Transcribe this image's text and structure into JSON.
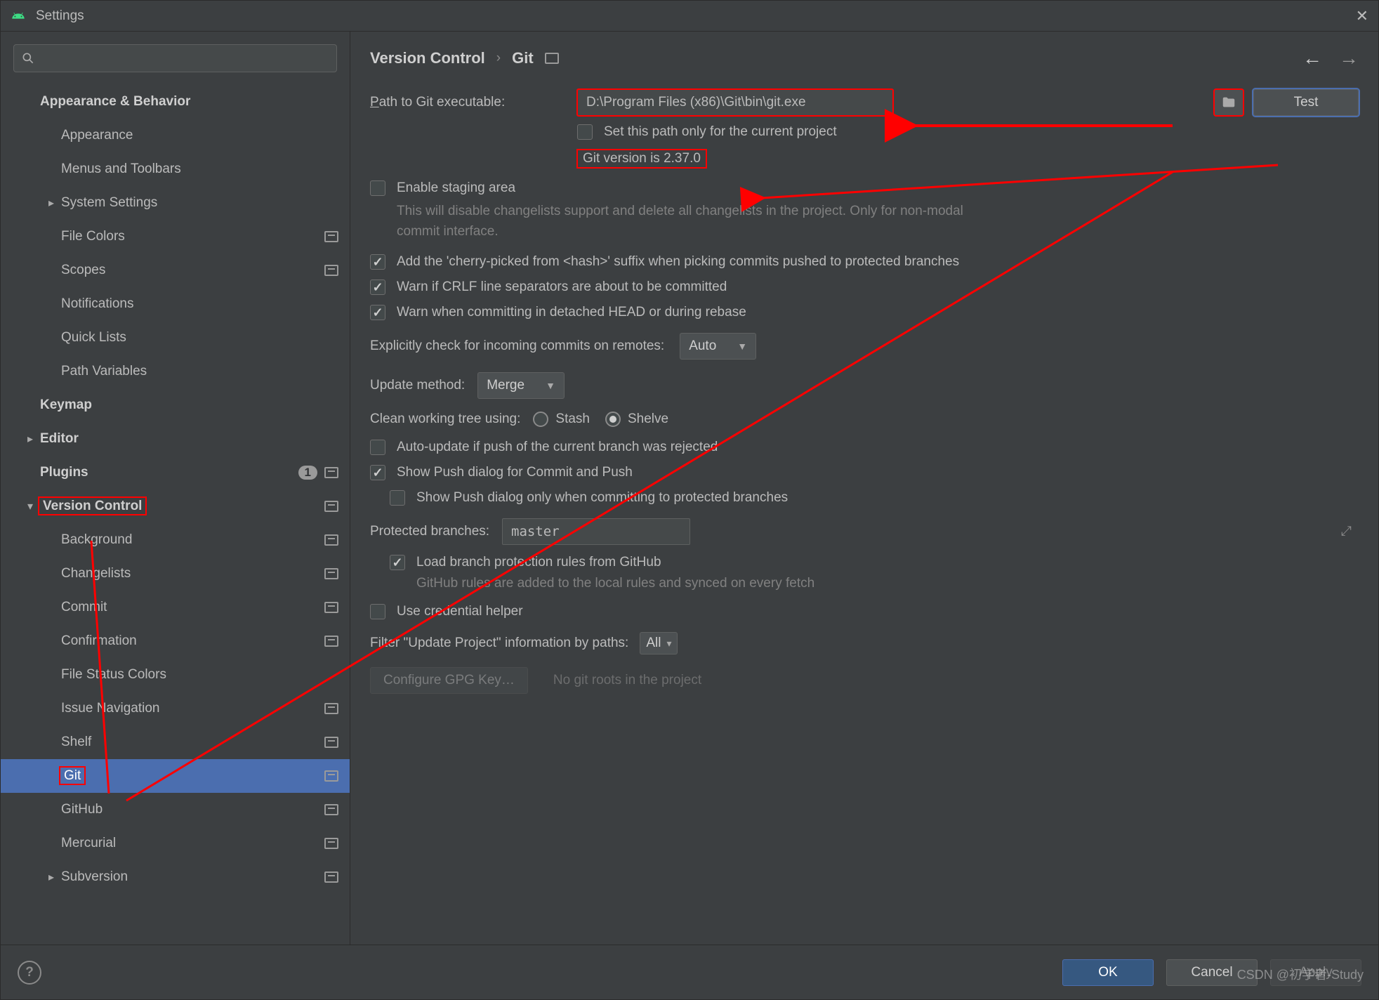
{
  "window": {
    "title": "Settings"
  },
  "breadcrumb": {
    "main": "Version Control",
    "sub": "Git"
  },
  "sidebar": {
    "items": [
      {
        "label": "Appearance & Behavior",
        "bold": true,
        "lvl": 0
      },
      {
        "label": "Appearance",
        "lvl": 1
      },
      {
        "label": "Menus and Toolbars",
        "lvl": 1
      },
      {
        "label": "System Settings",
        "lvl": 1,
        "arrow": "right"
      },
      {
        "label": "File Colors",
        "lvl": 1,
        "project": true
      },
      {
        "label": "Scopes",
        "lvl": 1,
        "project": true
      },
      {
        "label": "Notifications",
        "lvl": 1
      },
      {
        "label": "Quick Lists",
        "lvl": 1
      },
      {
        "label": "Path Variables",
        "lvl": 1
      },
      {
        "label": "Keymap",
        "bold": true,
        "lvl": 0
      },
      {
        "label": "Editor",
        "bold": true,
        "lvl": 0,
        "arrow": "right"
      },
      {
        "label": "Plugins",
        "bold": true,
        "lvl": 0,
        "badge": "1",
        "project": true
      },
      {
        "label": "Version Control",
        "bold": true,
        "lvl": 0,
        "arrow": "down",
        "project": true,
        "red": true
      },
      {
        "label": "Background",
        "lvl": 1,
        "project": true
      },
      {
        "label": "Changelists",
        "lvl": 1,
        "project": true
      },
      {
        "label": "Commit",
        "lvl": 1,
        "project": true
      },
      {
        "label": "Confirmation",
        "lvl": 1,
        "project": true
      },
      {
        "label": "File Status Colors",
        "lvl": 1
      },
      {
        "label": "Issue Navigation",
        "lvl": 1,
        "project": true
      },
      {
        "label": "Shelf",
        "lvl": 1,
        "project": true
      },
      {
        "label": "Git",
        "lvl": 1,
        "project": true,
        "selected": true,
        "red": true
      },
      {
        "label": "GitHub",
        "lvl": 1,
        "project": true
      },
      {
        "label": "Mercurial",
        "lvl": 1,
        "project": true
      },
      {
        "label": "Subversion",
        "lvl": 1,
        "arrow": "right",
        "project": true
      }
    ]
  },
  "git": {
    "path_label": "Path to Git executable:",
    "path_value": "D:\\Program Files (x86)\\Git\\bin\\git.exe",
    "test_btn": "Test",
    "set_project_only": "Set this path only for the current project",
    "version_text": "Git version is 2.37.0",
    "enable_staging": "Enable staging area",
    "enable_staging_hint": "This will disable changelists support and delete all changelists in the project. Only for non-modal commit interface.",
    "cherry_pick": "Add the 'cherry-picked from <hash>' suffix when picking commits pushed to protected branches",
    "warn_crlf": "Warn if CRLF line separators are about to be committed",
    "warn_detached": "Warn when committing in detached HEAD or during rebase",
    "explicit_check": "Explicitly check for incoming commits on remotes:",
    "explicit_value": "Auto",
    "update_method_label": "Update method:",
    "update_method_value": "Merge",
    "clean_tree_label": "Clean working tree using:",
    "stash": "Stash",
    "shelve": "Shelve",
    "auto_update": "Auto-update if push of the current branch was rejected",
    "show_push": "Show Push dialog for Commit and Push",
    "show_push_protected": "Show Push dialog only when committing to protected branches",
    "protected_label": "Protected branches:",
    "protected_value": "master",
    "load_branch_protection": "Load branch protection rules from GitHub",
    "load_branch_hint": "GitHub rules are added to the local rules and synced on every fetch",
    "use_credential": "Use credential helper",
    "filter_update_label": "Filter \"Update Project\" information by paths:",
    "filter_update_value": "All",
    "configure_gpg": "Configure GPG Key…",
    "no_roots": "No git roots in the project"
  },
  "footer": {
    "ok": "OK",
    "cancel": "Cancel",
    "apply": "Apply"
  },
  "watermark": "CSDN @初学者-Study"
}
